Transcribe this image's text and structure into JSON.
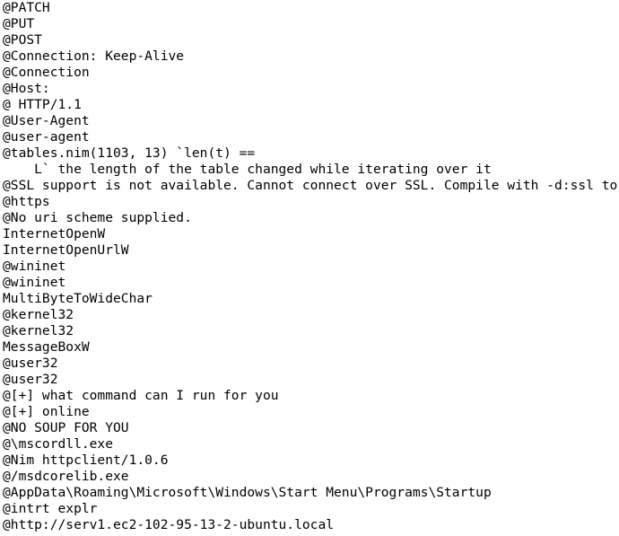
{
  "document": {
    "kind": "plain-text-output",
    "background_color": "#ffffff",
    "text_color": "#000000",
    "line_count": 33,
    "lines": [
      "@PATCH",
      "@PUT",
      "@POST",
      "@Connection: Keep-Alive",
      "@Connection",
      "@Host:",
      "@ HTTP/1.1",
      "@User-Agent",
      "@user-agent",
      "@tables.nim(1103, 13) `len(t) ==",
      "    L` the length of the table changed while iterating over it",
      "@SSL support is not available. Cannot connect over SSL. Compile with -d:ssl to enable.",
      "@https",
      "@No uri scheme supplied.",
      "InternetOpenW",
      "InternetOpenUrlW",
      "@wininet",
      "@wininet",
      "MultiByteToWideChar",
      "@kernel32",
      "@kernel32",
      "MessageBoxW",
      "@user32",
      "@user32",
      "@[+] what command can I run for you",
      "@[+] online",
      "@NO SOUP FOR YOU",
      "@\\mscordll.exe",
      "@Nim httpclient/1.0.6",
      "@/msdcorelib.exe",
      "@AppData\\Roaming\\Microsoft\\Windows\\Start Menu\\Programs\\Startup",
      "@intrt explr",
      "@http://serv1.ec2-102-95-13-2-ubuntu.local"
    ]
  }
}
